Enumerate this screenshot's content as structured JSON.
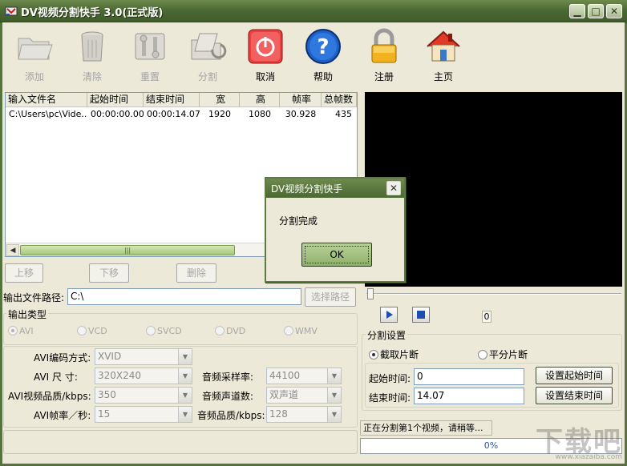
{
  "window": {
    "title": "DV视频分割快手 3.0(正式版)",
    "controls": [
      "▁",
      "□",
      "✕"
    ]
  },
  "toolbar": [
    {
      "id": "add",
      "label": "添加",
      "icon": "folder-icon",
      "enabled": false
    },
    {
      "id": "clear",
      "label": "清除",
      "icon": "trash-can-icon",
      "enabled": false
    },
    {
      "id": "reset",
      "label": "重置",
      "icon": "tools-icon",
      "enabled": false
    },
    {
      "id": "split",
      "label": "分割",
      "icon": "split-folder-icon",
      "enabled": false
    },
    {
      "id": "cancel",
      "label": "取消",
      "icon": "power-icon",
      "enabled": true
    },
    {
      "id": "help",
      "label": "帮助",
      "icon": "help-icon",
      "enabled": true
    },
    {
      "id": "register",
      "label": "注册",
      "icon": "lock-icon",
      "enabled": true
    },
    {
      "id": "home",
      "label": "主页",
      "icon": "home-icon",
      "enabled": true
    }
  ],
  "file_table": {
    "columns": [
      "输入文件名",
      "起始时间",
      "结束时间",
      "宽",
      "高",
      "帧率",
      "总帧数"
    ],
    "rows": [
      [
        "C:\\Users\\pc\\Vide...",
        "00:00:00.00",
        "00:00:14.07",
        "1920",
        "1080",
        "30.928",
        "435"
      ]
    ]
  },
  "list_buttons": {
    "up": "上移",
    "down": "下移",
    "delete": "删除"
  },
  "output_path": {
    "label": "输出文件路径:",
    "value": "C:\\",
    "browse": "选择路径"
  },
  "output_type": {
    "title": "输出类型",
    "options": [
      "AVI",
      "VCD",
      "SVCD",
      "DVD",
      "WMV"
    ],
    "selected": "AVI"
  },
  "avi_settings": {
    "codec_label": "AVI编码方式:",
    "codec_value": "XVID",
    "size_label": "AVI  尺  寸:",
    "size_value": "320X240",
    "quality_label": "AVI视频品质/kbps:",
    "quality_value": "350",
    "fps_label": "AVI帧率／秒:",
    "fps_value": "15",
    "sample_rate_label": "音频采样率:",
    "sample_rate_value": "44100",
    "channels_label": "音频声道数:",
    "channels_value": "双声道",
    "audio_quality_label": "音频品质/kbps:",
    "audio_quality_value": "128"
  },
  "player": {
    "position": "0"
  },
  "split_settings": {
    "title": "分割设置",
    "mode_clip": "截取片断",
    "mode_even": "平分片断",
    "start_label": "起始时间:",
    "start_value": "0",
    "end_label": "结束时间:",
    "end_value": "14.07",
    "set_start": "设置起始时间",
    "set_end": "设置结束时间"
  },
  "status": {
    "text": "正在分割第1个视频，请稍等...",
    "progress": "0%"
  },
  "dialog": {
    "title": "DV视频分割快手",
    "message": "分割完成",
    "ok": "OK",
    "close": "✕"
  },
  "watermark": {
    "text": "下载吧",
    "url": "www.xiazaiba.com"
  }
}
